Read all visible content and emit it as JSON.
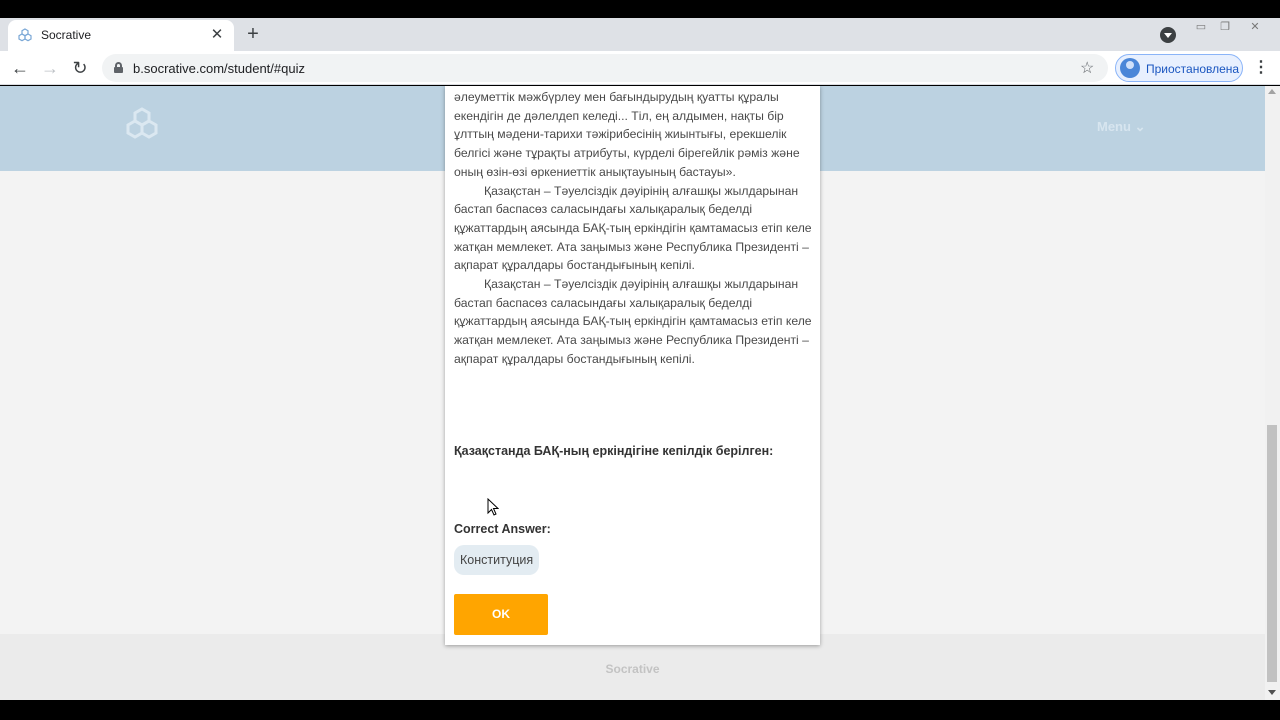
{
  "browser": {
    "tab_title": "Socrative",
    "tab_close": "✕",
    "new_tab": "+",
    "url": "b.socrative.com/student/#quiz",
    "profile_label": "Приостановлена",
    "icons": [
      "socrative-favicon",
      "close-icon",
      "plus-icon",
      "tab-search-icon",
      "back-icon",
      "forward-icon",
      "reload-icon",
      "lock-icon",
      "star-icon",
      "profile-icon",
      "kebab-menu-icon",
      "minimize-icon",
      "restore-icon",
      "window-close-icon"
    ]
  },
  "site": {
    "menu_label": "Menu",
    "footer_brand": "Socrative"
  },
  "quiz": {
    "passage": [
      "әлеуметтік мәжбүрлеу мен бағындырудың қуатты құралы екендігін де дәлелдеп келеді... Тіл, ең алдымен, нақты бір ұлттың мәдени-тарихи тәжірибесінің жиынтығы, ерекшелік белгісі және тұрақты атрибуты, күрделі бірегейлік рәміз және оның өзін-өзі өркениеттік анықтауының бастауы».",
      "Қазақстан – Тәуелсіздік дәуірінің алғашқы жылдарынан бастап баспасөз саласындағы халықаралық беделді құжаттардың аясында БАҚ-тың еркіндігін қамтамасыз етіп келе жатқан мемлекет. Ата заңымыз және Республика Президенті – ақпарат құралдары бостандығының кепілі.",
      "Қазақстан – Тәуелсіздік дәуірінің алғашқы жылдарынан бастап баспасөз саласындағы халықаралық беделді құжаттардың аясында БАҚ-тың еркіндігін қамтамасыз етіп келе жатқан мемлекет. Ата заңымыз және Республика Президенті – ақпарат құралдары бостандығының кепілі."
    ],
    "question": "Қазақстанда БАҚ-ның еркіндігіне кепілдік берілген:",
    "correct_label": "Correct Answer:",
    "correct_answer": "Конституция",
    "ok_label": "OK"
  },
  "colors": {
    "header": "#bcd2e1",
    "ok_button": "#ffa500",
    "answer_chip": "#e3ecf2"
  }
}
